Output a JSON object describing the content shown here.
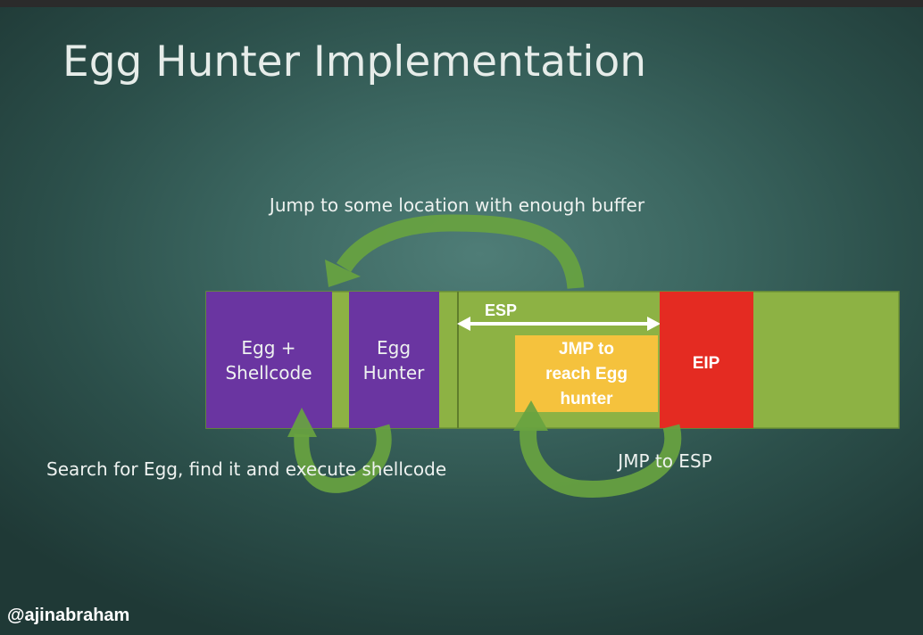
{
  "slide": {
    "title": "Egg Hunter Implementation",
    "watermark": "@ajinabraham"
  },
  "annotations": {
    "jump_top": "Jump to some location with enough buffer",
    "search_bottom": "Search for Egg, find it and execute shellcode",
    "jmp_to_esp": "JMP to ESP"
  },
  "buffer": {
    "egg_shellcode_line1": "Egg +",
    "egg_shellcode_line2": "Shellcode",
    "egg_hunter_line1": "Egg",
    "egg_hunter_line2": "Hunter",
    "esp_label": "ESP",
    "jmp_box_line1": "JMP to",
    "jmp_box_line2": "reach Egg",
    "jmp_box_line3": "hunter",
    "eip_label": "EIP"
  },
  "colors": {
    "buffer_green": "#8db244",
    "purple": "#6a35a1",
    "yellow": "#f5c23d",
    "red": "#e42b22",
    "arrow_green": "#68a340"
  }
}
